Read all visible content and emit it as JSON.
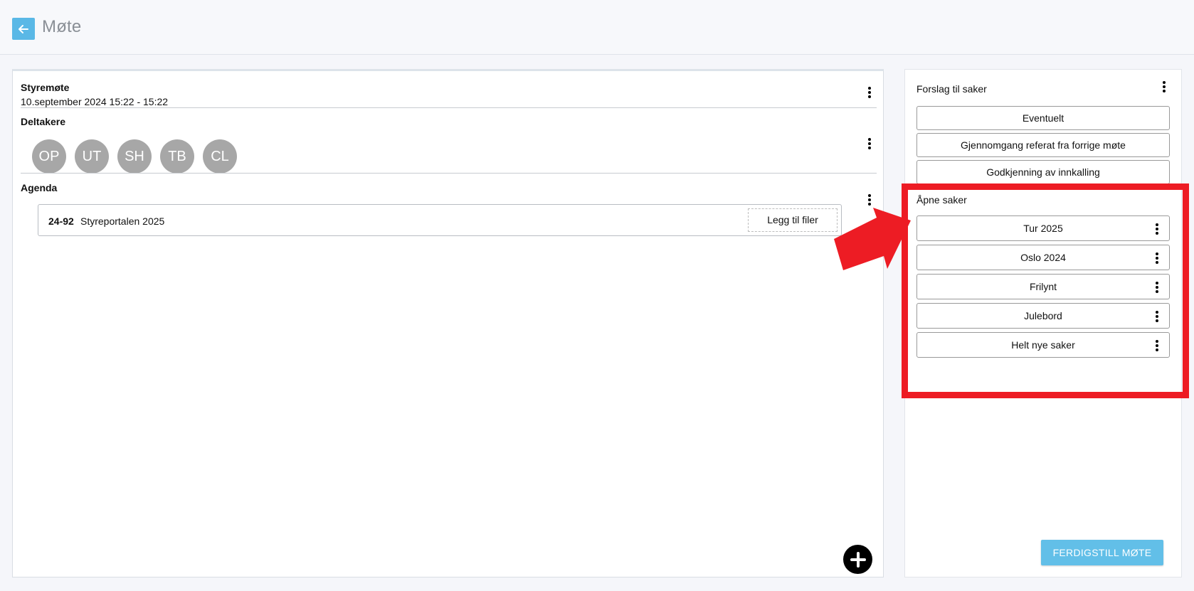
{
  "header": {
    "back_icon": "arrow-left-icon",
    "title": "Møte"
  },
  "meeting": {
    "title": "Styremøte",
    "date": "10.september 2024 15:22 - 15:22",
    "participants_label": "Deltakere",
    "participants": [
      "OP",
      "UT",
      "SH",
      "TB",
      "CL"
    ],
    "agenda_label": "Agenda",
    "agenda_items": [
      {
        "number": "24-92",
        "name": "Styreportalen 2025",
        "add_files_label": "Legg til filer"
      }
    ]
  },
  "sidebar": {
    "suggestions_label": "Forslag til saker",
    "suggestions": [
      "Eventuelt",
      "Gjennomgang referat fra forrige møte",
      "Godkjenning av innkalling"
    ],
    "open_cases_label": "Åpne saker",
    "open_cases": [
      "Tur 2025",
      "Oslo 2024",
      "Frilynt",
      "Julebord",
      "Helt nye saker"
    ],
    "finish_button": "FERDIGSTILL MØTE"
  },
  "colors": {
    "accent": "#5ab8e6",
    "finish_button": "#62bfe8",
    "avatar": "#a7a7a7",
    "annotation": "#ed1c24"
  }
}
